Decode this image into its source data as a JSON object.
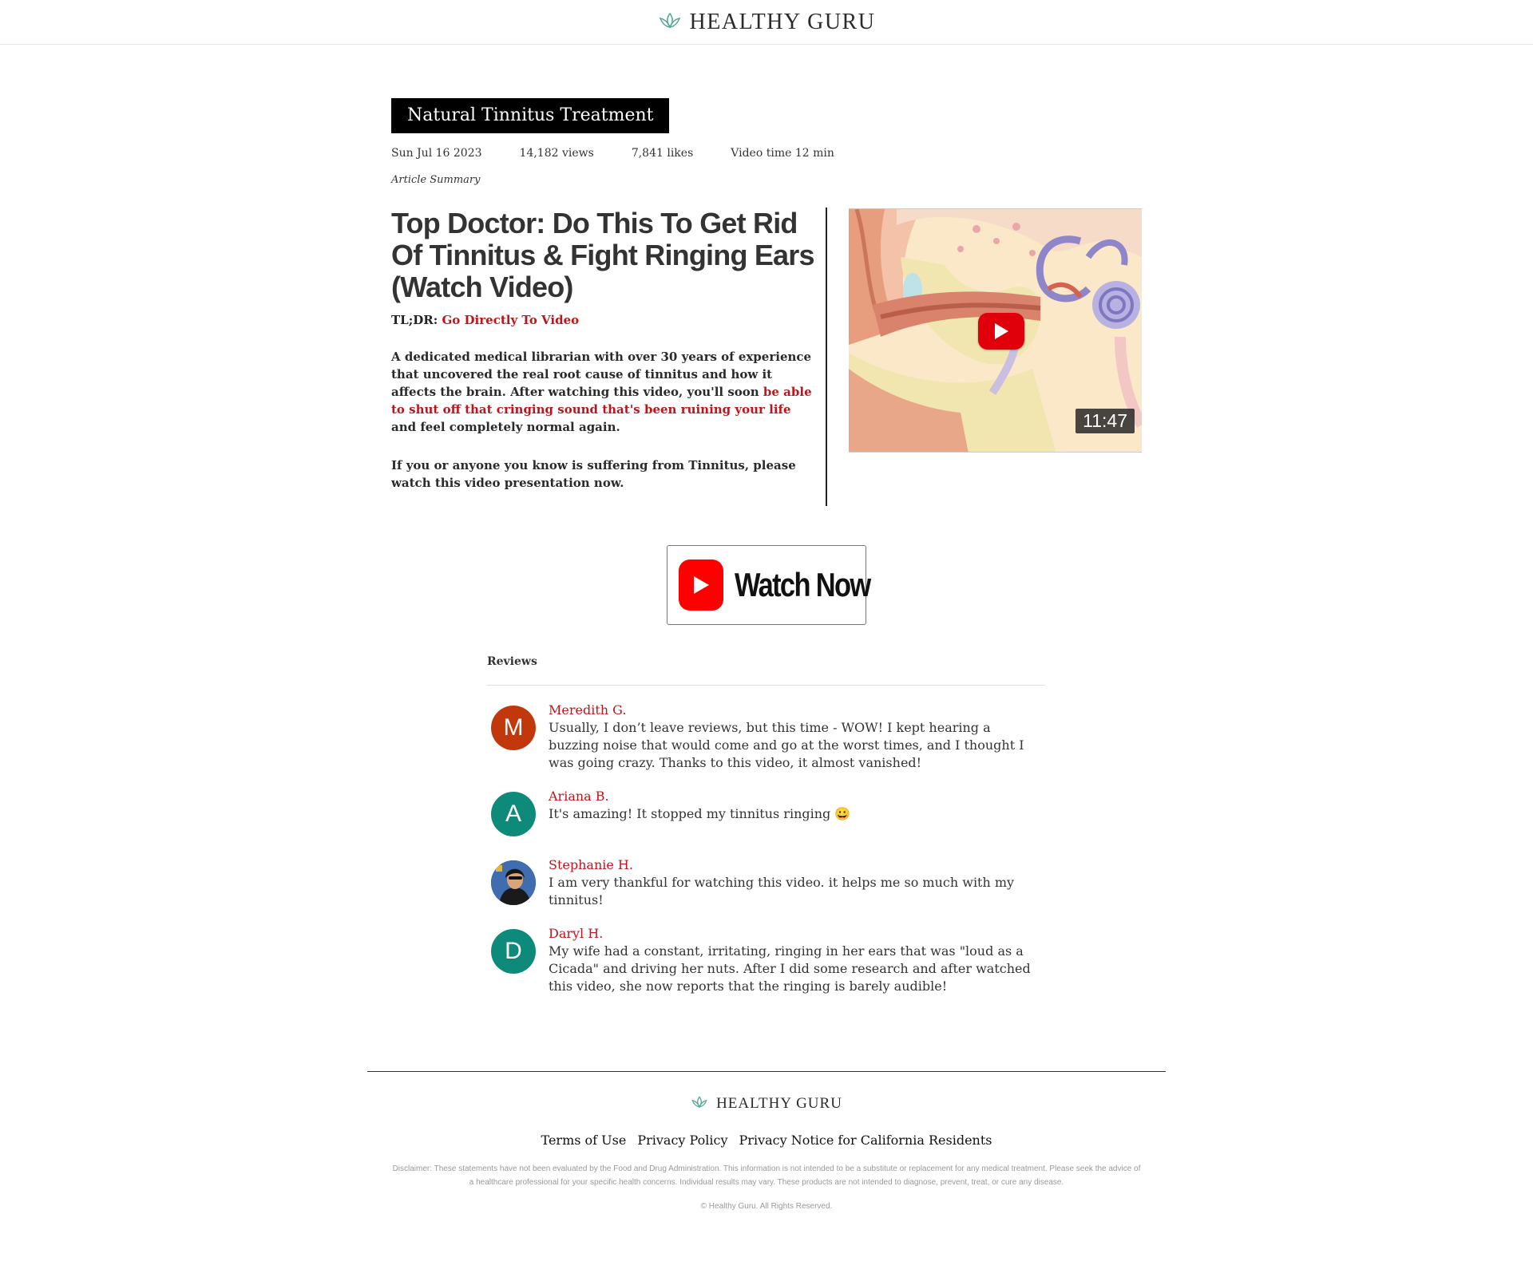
{
  "header": {
    "brand": "HEALTHY GURU",
    "logo_icon": "lotus-icon"
  },
  "article": {
    "category": "Natural Tinnitus Treatment",
    "date": "Sun Jul 16 2023",
    "views": "14,182 views",
    "likes": "7,841 likes",
    "video_time": "Video time 12 min",
    "summary_label": "Article Summary",
    "headline": "Top Doctor: Do This To Get Rid Of Tinnitus & Fight Ringing Ears (Watch Video)",
    "tldr_label": "TL;DR:",
    "tldr_link": "Go Directly To Video",
    "para1_start": "A dedicated medical librarian with over 30 years of experience that uncovered the real root cause of tinnitus and how it affects the brain. After watching this video, you'll soon ",
    "para1_highlight": "be able to shut off that cringing sound that's been ruining your life",
    "para1_end": " and feel completely normal again.",
    "para2": "If you or anyone you know is suffering from Tinnitus, please watch this video presentation now."
  },
  "video": {
    "duration": "11:47",
    "play_icon": "play-icon"
  },
  "watch_now": {
    "label": "Watch Now",
    "icon": "youtube-play-icon"
  },
  "reviews": {
    "title": "Reviews",
    "items": [
      {
        "initial": "M",
        "name": "Meredith G.",
        "text": "Usually, I don’t leave reviews, but this time - WOW! I kept hearing a buzzing noise that would come and go at the worst times, and I thought I was going crazy. Thanks to this video, it almost vanished!",
        "color": "#c2380d"
      },
      {
        "initial": "A",
        "name": "Ariana B.",
        "text": "It's amazing! It stopped my tinnitus ringing 😀",
        "color": "#0e8a7a"
      },
      {
        "initial": "",
        "name": "Stephanie H.",
        "text": "I am very thankful for watching this video. it helps me so much with my tinnitus!",
        "color": "#2e4d7a"
      },
      {
        "initial": "D",
        "name": "Daryl H.",
        "text": "My wife had a constant, irritating, ringing in her ears that was \"loud as a Cicada\" and driving her nuts. After I did some research and after watched this video, she now reports that the ringing is barely audible!",
        "color": "#0e8a7a"
      }
    ]
  },
  "footer": {
    "brand": "HEALTHY GURU",
    "links": [
      "Terms of Use",
      "Privacy Policy",
      "Privacy Notice for California Residents"
    ],
    "disclaimer": "Disclaimer: These statements have not been evaluated by the Food and Drug Administration. This information is not intended to be a substitute or replacement for any medical treatment. Please seek the advice of a healthcare professional for your specific health concerns. Individual results may vary. These products are not intended to diagnose, prevent, treat, or cure any disease.",
    "copyright": "© Healthy Guru. All Rights Reserved."
  },
  "colors": {
    "accent_red": "#c0141a",
    "brand_teal": "#5aa89a"
  }
}
